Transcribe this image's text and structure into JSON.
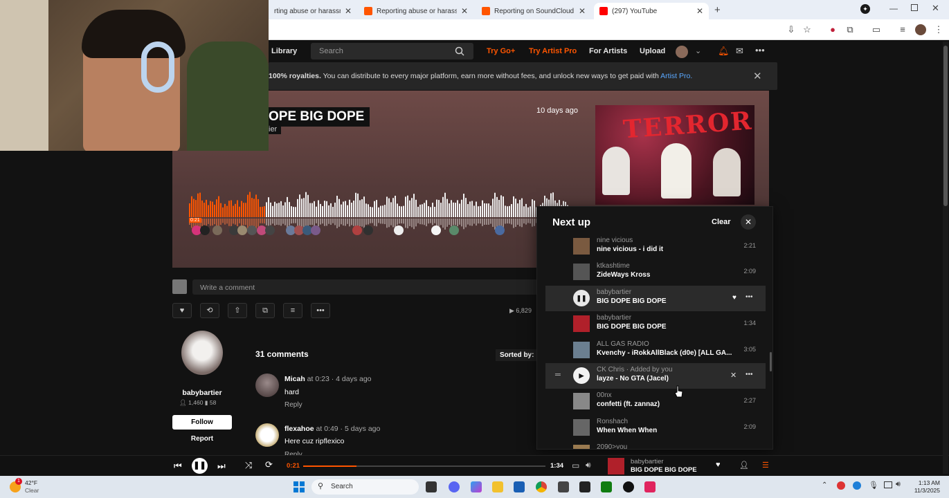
{
  "browser": {
    "tabs": [
      {
        "label": "rting abuse or harassment",
        "color": "#ff5500"
      },
      {
        "label": "Reporting abuse or harassment",
        "color": "#ff5500"
      },
      {
        "label": "Reporting on SoundCloud – So",
        "color": "#ff5500"
      },
      {
        "label": "(297) YouTube",
        "color": "#ff0000"
      }
    ],
    "new_tab": "+"
  },
  "nav": {
    "library": "Library",
    "search_placeholder": "Search",
    "try_go": "Try Go+",
    "try_artist_pro": "Try Artist Pro",
    "for_artists": "For Artists",
    "upload": "Upload"
  },
  "banner": {
    "bold": "100% royalties.",
    "text": " You can distribute to every major platform, earn more without fees, and unlock new ways to get paid with ",
    "link": "Artist Pro."
  },
  "track": {
    "title": "OPE BIG DOPE",
    "artist": "ier",
    "posted": "10 days ago",
    "artwork_text": "TERROR",
    "current_time_badge": "0:21",
    "progress": 0.2,
    "comment_placeholder": "Write a comment",
    "plays": "6,829"
  },
  "profile": {
    "name": "babybartier",
    "followers": "1,460",
    "tracks": "58",
    "follow": "Follow",
    "report": "Report"
  },
  "comments": {
    "count": "31 comments",
    "sorted_by": "Sorted by:",
    "items": [
      {
        "user": "Micah",
        "at": " at ",
        "time": "0:23",
        "ago": " · 4 days ago",
        "text": "hard",
        "reply": "Reply"
      },
      {
        "user": "flexahoe",
        "at": " at ",
        "time": "0:49",
        "ago": " · 5 days ago",
        "text": "Here cuz ripflexico",
        "reply": "Reply"
      }
    ]
  },
  "nextup": {
    "title": "Next up",
    "clear": "Clear",
    "items": [
      {
        "artist": "nine vicious",
        "title": "nine vicious - i did it",
        "duration": "2:21",
        "thumb": "#7a5a40"
      },
      {
        "artist": "ktkashtime",
        "title": "ZideWays Kross",
        "duration": "2:09",
        "thumb": "#555555"
      },
      {
        "artist": "babybartier",
        "title": "BIG DOPE BIG DOPE",
        "duration": "",
        "thumb": "#b0202a",
        "state": "playing"
      },
      {
        "artist": "babybartier",
        "title": "BIG DOPE BIG DOPE",
        "duration": "1:34",
        "thumb": "#b0202a"
      },
      {
        "artist": "ALL GAS RADIO",
        "title": "Kvenchy - iRokkAllBlack (d0e) [ALL GA...",
        "duration": "3:05",
        "thumb": "#6b7f90"
      },
      {
        "artist": "CK Chris",
        "added": "Added by you",
        "title": "layze - No GTA (Jacel)",
        "duration": "",
        "thumb": "#333333",
        "state": "hover"
      },
      {
        "artist": "00nx",
        "title": "confetti (ft. zannaz)",
        "duration": "2:27",
        "thumb": "#888888"
      },
      {
        "artist": "Ronshach",
        "title": "When When When",
        "duration": "2:09",
        "thumb": "#666666"
      },
      {
        "artist": "2090>you",
        "title": "",
        "duration": "",
        "thumb": "#9a7a50"
      }
    ]
  },
  "player": {
    "elapsed": "0:21",
    "total": "1:34",
    "progress": 0.22,
    "artist": "babybartier",
    "title": "BIG DOPE BIG DOPE"
  },
  "taskbar": {
    "weather_temp": "42°F",
    "weather_desc": "Clear",
    "search": "Search",
    "time": "1:13 AM",
    "date": "11/3/2025",
    "badge": "1"
  }
}
